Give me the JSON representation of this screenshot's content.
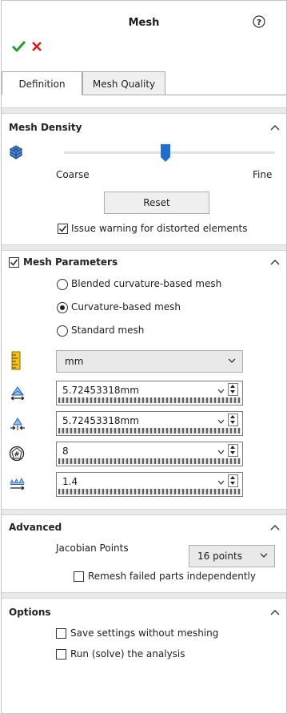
{
  "header": {
    "title": "Mesh"
  },
  "tabs": [
    {
      "label": "Definition",
      "active": true
    },
    {
      "label": "Mesh Quality",
      "active": false
    }
  ],
  "mesh_density": {
    "title": "Mesh Density",
    "coarse_label": "Coarse",
    "fine_label": "Fine",
    "slider_level": 0.5,
    "reset_label": "Reset",
    "warning_label": "Issue warning for distorted elements",
    "warning_checked": true
  },
  "mesh_parameters": {
    "title": "Mesh Parameters",
    "enabled": true,
    "options": [
      {
        "label": "Blended curvature-based mesh",
        "selected": false
      },
      {
        "label": "Curvature-based mesh",
        "selected": true
      },
      {
        "label": "Standard mesh",
        "selected": false
      }
    ],
    "unit": "mm",
    "max_element_size": "5.72453318mm",
    "min_element_size": "5.72453318mm",
    "min_elements_in_circle": "8",
    "growth_ratio": "1.4"
  },
  "advanced": {
    "title": "Advanced",
    "jacobian_label": "Jacobian Points",
    "jacobian_value": "16 points",
    "remesh_label": "Remesh failed parts independently",
    "remesh_checked": false
  },
  "options": {
    "title": "Options",
    "save_label": "Save settings without meshing",
    "save_checked": false,
    "run_label": "Run (solve) the analysis",
    "run_checked": false
  },
  "colors": {
    "accent": "#1f6fd1",
    "ok": "#2e9a2e",
    "cancel": "#d42020"
  },
  "icons": [
    "help-icon",
    "ok-icon",
    "cancel-icon",
    "mesh-density-icon",
    "ruler-icon",
    "max-element-size-icon",
    "min-element-size-icon",
    "min-elements-in-circle-icon",
    "growth-ratio-icon",
    "collapse-chevron-icon",
    "dropdown-caret-icon"
  ]
}
